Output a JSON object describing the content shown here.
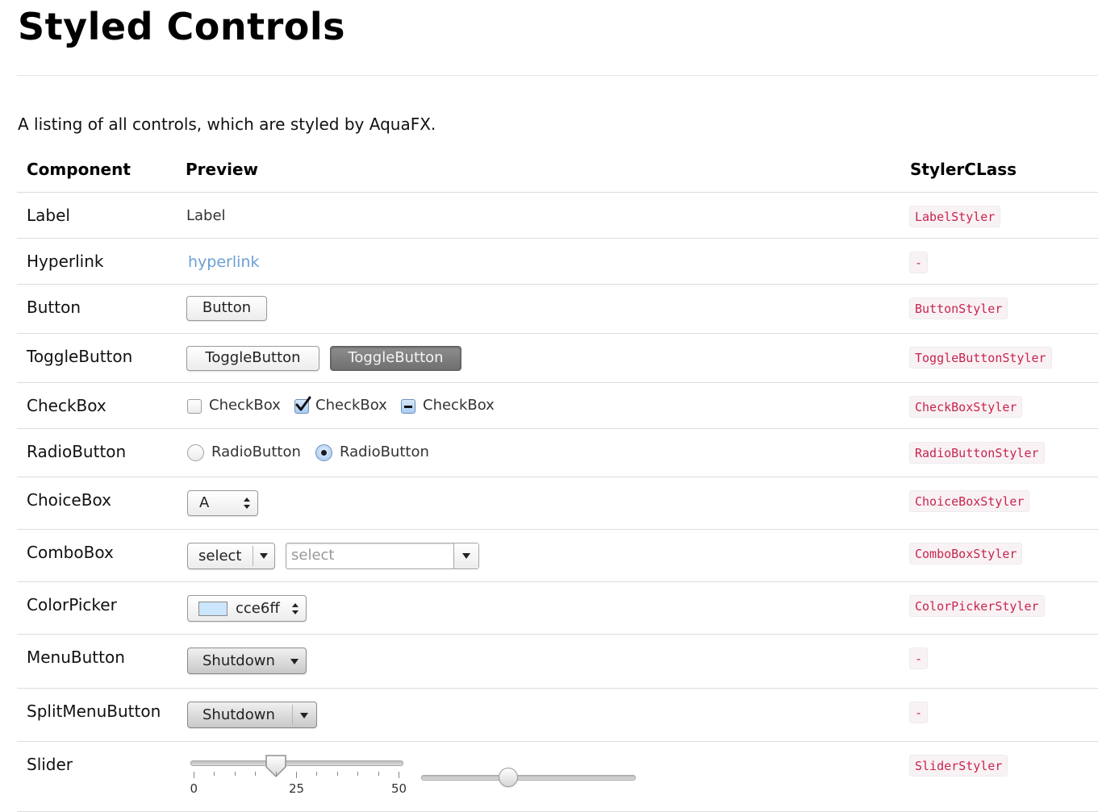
{
  "page": {
    "title": "Styled Controls",
    "intro": "A listing of all controls, which are styled by AquaFX."
  },
  "table": {
    "headers": {
      "component": "Component",
      "preview": "Preview",
      "styler_class": "StylerCLass"
    },
    "rows": {
      "label": {
        "component": "Label",
        "styler": "LabelStyler",
        "preview_text": "Label"
      },
      "hyperlink": {
        "component": "Hyperlink",
        "styler": "-",
        "preview_text": "hyperlink",
        "link_color": "#6a9fd4"
      },
      "button": {
        "component": "Button",
        "styler": "ButtonStyler",
        "button_label": "Button"
      },
      "togglebutton": {
        "component": "ToggleButton",
        "styler": "ToggleButtonStyler",
        "label_unselected": "ToggleButton",
        "label_selected": "ToggleButton"
      },
      "checkbox": {
        "component": "CheckBox",
        "styler": "CheckBoxStyler",
        "labels": [
          "CheckBox",
          "CheckBox",
          "CheckBox"
        ],
        "states": [
          "unchecked",
          "checked",
          "indeterminate"
        ]
      },
      "radiobutton": {
        "component": "RadioButton",
        "styler": "RadioButtonStyler",
        "labels": [
          "RadioButton",
          "RadioButton"
        ],
        "states": [
          "unselected",
          "selected"
        ]
      },
      "choicebox": {
        "component": "ChoiceBox",
        "styler": "ChoiceBoxStyler",
        "selected_value": "A",
        "icon": "updown-arrows-icon"
      },
      "combobox": {
        "component": "ComboBox",
        "styler": "ComboBoxStyler",
        "value": "select",
        "editable_placeholder": "select",
        "icon": "dropdown-arrow-icon"
      },
      "colorpicker": {
        "component": "ColorPicker",
        "styler": "ColorPickerStyler",
        "value": "cce6ff",
        "swatch_color": "#cce6ff"
      },
      "menubutton": {
        "component": "MenuButton",
        "styler": "-",
        "label": "Shutdown"
      },
      "splitmenubutton": {
        "component": "SplitMenuButton",
        "styler": "-",
        "label": "Shutdown"
      },
      "slider": {
        "component": "Slider",
        "styler": "SliderStyler",
        "tick_slider": {
          "min": 0,
          "max": 50,
          "value": 20,
          "tick_labels": [
            "0",
            "25",
            "50"
          ]
        },
        "plain_slider": {
          "min": 0,
          "max": 100,
          "value": 40
        }
      }
    }
  },
  "colors": {
    "code_text": "#c7254e",
    "code_bg": "#f9f2f4",
    "row_border": "#dcdcdc"
  }
}
